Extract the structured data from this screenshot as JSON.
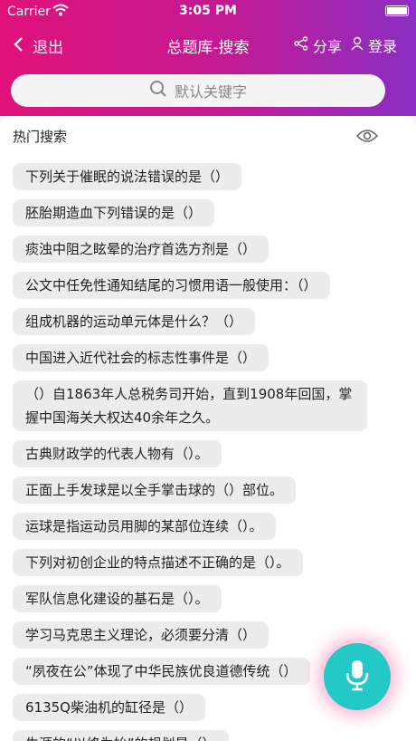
{
  "status_bar": {
    "carrier": "Carrier",
    "time": "3:05 PM"
  },
  "nav": {
    "back_label": "退出",
    "title": "总题库-搜索",
    "share_label": "分享",
    "login_label": "登录"
  },
  "search": {
    "placeholder": "默认关键字"
  },
  "hot_search": {
    "title": "热门搜索",
    "items": [
      "下列关于催眠的说法错误的是（）",
      "胚胎期造血下列错误的是（）",
      "痰浊中阻之眩晕的治疗首选方剂是（）",
      "公文中任免性通知结尾的习惯用语一般使用：（）",
      "组成机器的运动单元体是什么？（）",
      "中国进入近代社会的标志性事件是（）",
      "（）自1863年人总税务司开始，直到1908年回国，掌握中国海关大权达40余年之久。",
      "古典财政学的代表人物有（）。",
      "正面上手发球是以全手掌击球的（）部位。",
      "运球是指运动员用脚的某部位连续（）。",
      "下列对初创企业的特点描述不正确的是（）。",
      "军队信息化建设的基石是（）。",
      "学习马克思主义理论，必须要分清（）",
      "“夙夜在公”体现了中华民族优良道德传统（）",
      "6135Q柴油机的缸径是（）",
      "生涯的“以终为始”的规划是（）"
    ]
  },
  "icons": {
    "back": "chevron-left-icon",
    "share": "share-icon",
    "login": "user-icon",
    "search": "search-icon",
    "eye": "eye-icon",
    "mic": "microphone-icon"
  },
  "colors": {
    "header_start": "#e0127a",
    "header_end": "#8a2fc4",
    "mic_button": "#24c8c6"
  }
}
